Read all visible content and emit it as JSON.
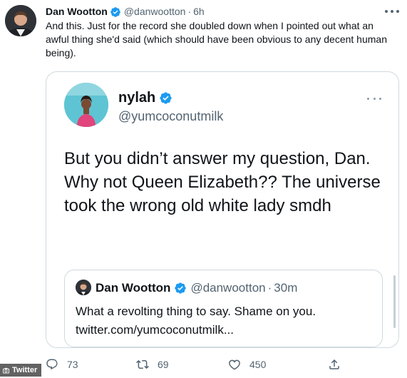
{
  "tweet": {
    "name": "Dan Wootton",
    "handle": "@danwootton",
    "separator": "·",
    "time": "6h",
    "text": "And this. Just for the record she doubled down when I pointed out what an awful thing she'd said (which should have been obvious to any decent human being)."
  },
  "embedded": {
    "name": "nylah",
    "handle": "@yumcoconutmilk",
    "text": "But you didn’t answer my question, Dan. Why not Queen Elizabeth?? The universe took the wrong old white lady smdh",
    "quoted": {
      "name": "Dan Wootton",
      "handle": "@danwootton",
      "separator": "·",
      "time": "30m",
      "line1": "What a revolting thing to say. Shame on you.",
      "line2": "twitter.com/yumcoconutmilk..."
    }
  },
  "actions": {
    "replies": "73",
    "retweets": "69",
    "likes": "450"
  },
  "watermark": "Twitter",
  "icons": {
    "verified": "verified-badge-icon",
    "more": "more-dots-icon",
    "reply": "reply-icon",
    "retweet": "retweet-icon",
    "like": "heart-icon",
    "share": "share-icon",
    "watermark": "camera-icon"
  },
  "colors": {
    "verified": "#1d9bf0",
    "text": "#0f1419",
    "secondary": "#536471",
    "border": "#cfd9de"
  }
}
